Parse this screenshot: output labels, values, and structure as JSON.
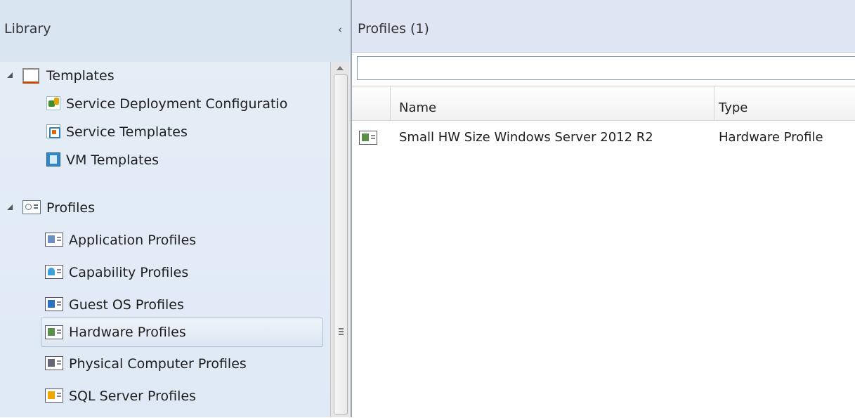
{
  "library": {
    "title": "Library",
    "collapse_glyph": "‹",
    "tree": {
      "templates": {
        "label": "Templates",
        "icon": "templates-icon",
        "children": [
          {
            "label": "Service Deployment Configuratio",
            "icon": "service-deployment-configuration-icon"
          },
          {
            "label": "Service Templates",
            "icon": "service-templates-icon"
          },
          {
            "label": "VM Templates",
            "icon": "vm-templates-icon"
          }
        ]
      },
      "profiles": {
        "label": "Profiles",
        "icon": "profiles-icon",
        "children": [
          {
            "label": "Application Profiles",
            "icon": "application-profile-icon"
          },
          {
            "label": "Capability Profiles",
            "icon": "capability-profile-icon"
          },
          {
            "label": "Guest OS Profiles",
            "icon": "guest-os-profile-icon"
          },
          {
            "label": "Hardware Profiles",
            "icon": "hardware-profile-icon",
            "selected": true
          },
          {
            "label": "Physical Computer Profiles",
            "icon": "physical-computer-profile-icon"
          },
          {
            "label": "SQL Server Profiles",
            "icon": "sql-server-profile-icon"
          }
        ]
      }
    }
  },
  "main": {
    "title": "Profiles (1)",
    "search": {
      "value": "",
      "placeholder": ""
    },
    "columns": {
      "name": "Name",
      "type": "Type"
    },
    "rows": [
      {
        "name": "Small HW Size Windows Server 2012 R2",
        "type": "Hardware Profile",
        "icon": "hardware-profile-icon"
      }
    ]
  },
  "colors": {
    "pane_background": "#e6eef7",
    "header_background": "#dde6f2",
    "selection_border": "#a9bdd6",
    "search_border": "#7c98b7"
  }
}
